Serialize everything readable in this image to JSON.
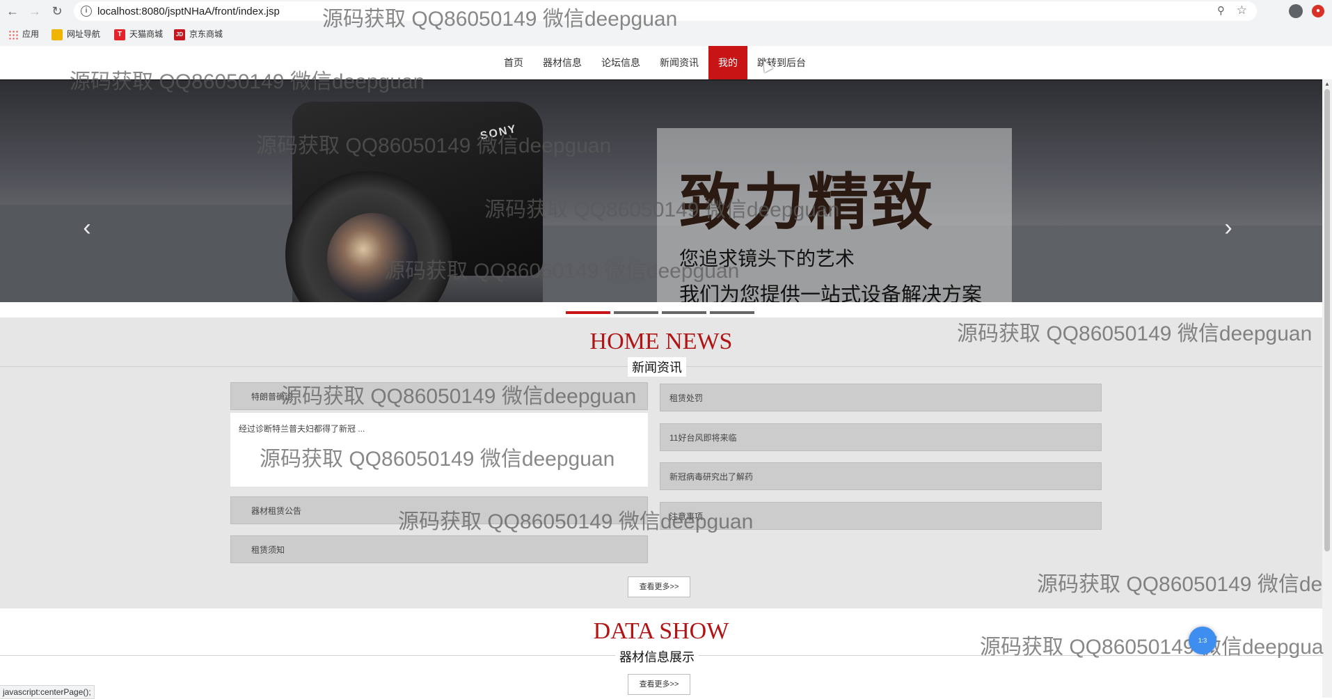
{
  "browser": {
    "url": "localhost:8080/jsptNHaA/front/index.jsp",
    "bookmarks": [
      {
        "label": "应用",
        "icon": "apps-grid-icon"
      },
      {
        "label": "网址导航",
        "icon": "bookmark-folder-icon"
      },
      {
        "label": "天猫商城",
        "icon": "tmall-icon",
        "badge": "T"
      },
      {
        "label": "京东商城",
        "icon": "jd-icon",
        "badge": "JD"
      }
    ],
    "status_text": "javascript:centerPage();"
  },
  "nav": {
    "items": [
      "首页",
      "器材信息",
      "论坛信息",
      "新闻资讯",
      "我的",
      "跳转到后台"
    ],
    "active_index": 4
  },
  "banner": {
    "camera_brand": "SONY",
    "headline": "致力精致",
    "subline1": "您追求镜头下的艺术",
    "subline2": "我们为您提供一站式设备解决方案",
    "slide_count": 4,
    "active_slide": 0
  },
  "home_news": {
    "title_en": "HOME NEWS",
    "title_cn": "新闻资讯",
    "left_items": [
      "特朗普确诊",
      "器材租赁公告",
      "租赁须知"
    ],
    "left_expanded_text": "经过诊断特兰普夫妇都得了新冠 ...",
    "right_items": [
      "租赁处罚",
      "11好台风即将来临",
      "新冠病毒研究出了解药",
      "注意事项"
    ],
    "more_label": "查看更多>>"
  },
  "data_show": {
    "title_en": "DATA SHOW",
    "title_cn": "器材信息展示",
    "more_label": "查看更多>>"
  },
  "watermark": {
    "text": "源码获取 QQ86050149 微信deepguan",
    "partial_1": "源码获取 QQ86050149 微信deepgua",
    "partial_2": "源码获取 QQ86050149 微信de"
  },
  "floating_badge": "1:3",
  "colors": {
    "accent": "#c81414",
    "section_bg": "#e6e6e6"
  }
}
